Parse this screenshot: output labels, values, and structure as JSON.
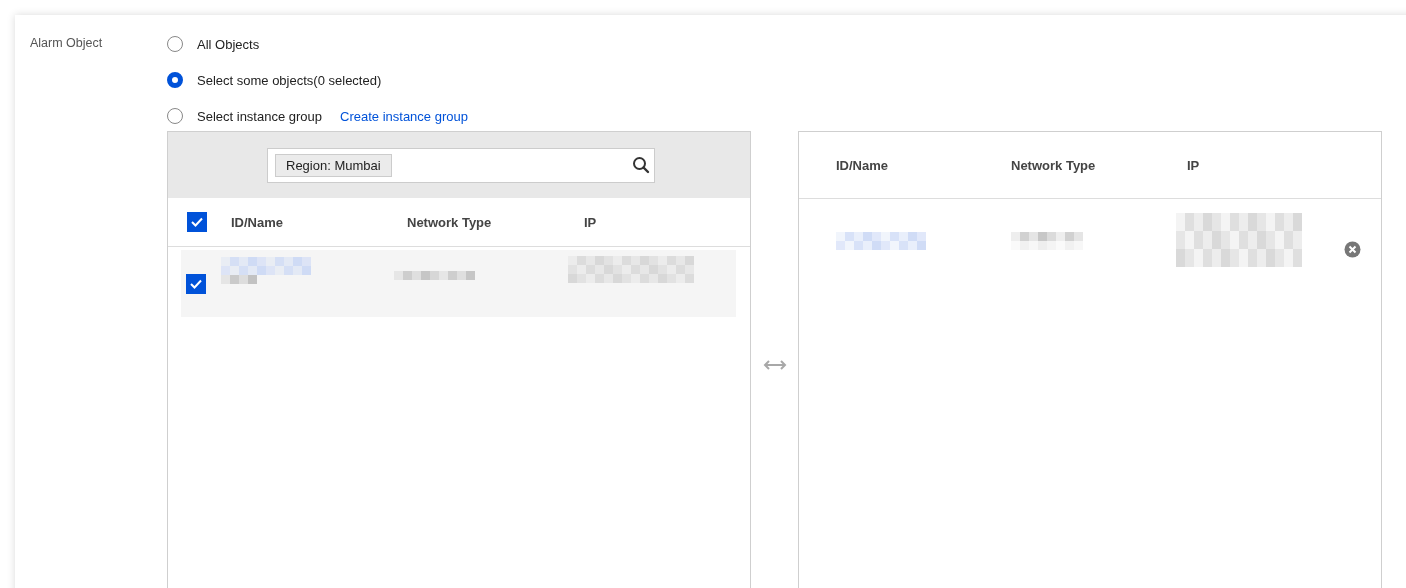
{
  "field_label": "Alarm Object",
  "options": [
    {
      "label": "All Objects",
      "selected": false
    },
    {
      "label": "Select some objects",
      "note": "(0 selected)",
      "selected": true
    },
    {
      "label": "Select instance group",
      "link": "Create instance group",
      "selected": false
    }
  ],
  "source": {
    "search": {
      "tag": "Region: Mumbai"
    },
    "select_all_checked": true,
    "columns": [
      "ID/Name",
      "Network Type",
      "IP"
    ],
    "rows": [
      {
        "checked": true
      }
    ]
  },
  "target": {
    "columns": [
      "ID/Name",
      "Network Type",
      "IP"
    ],
    "rows": [
      {
        "removable": true
      }
    ]
  }
}
